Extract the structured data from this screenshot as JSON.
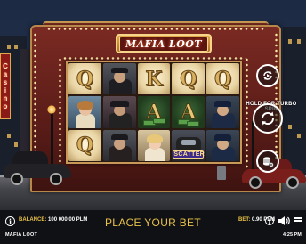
{
  "game": {
    "logo_text": "MAFIA LOOT",
    "side_sign": [
      "C",
      "a",
      "s",
      "i",
      "n",
      "o"
    ],
    "turbo_hint": "HOLD FOR TURBO SPIN",
    "reels": [
      [
        "Q",
        "mobster",
        "K",
        "Q",
        "Q"
      ],
      [
        "lady",
        "boss",
        "A",
        "A",
        "cop"
      ],
      [
        "Q",
        "mobster2",
        "blonde",
        "SCATTER",
        "cop2"
      ]
    ],
    "scatter_label": "SCATTER"
  },
  "bottom_bar": {
    "balance_label": "BALANCE:",
    "balance_value": "100 000.00 PLM",
    "place_bet": "PLACE YOUR BET",
    "bet_label": "BET:",
    "bet_value": "0.90 PLM",
    "game_name": "MAFIA LOOT",
    "time": "4:25 PM"
  },
  "icons": {
    "info": "info-icon",
    "autoplay": "autoplay-icon",
    "spin": "spin-icon",
    "bet_coins": "coins-icon",
    "sound": "sound-icon",
    "menu": "menu-icon"
  },
  "colors": {
    "accent_gold": "#e8c24a",
    "theater_red": "#5a1c18",
    "bar_bg": "#101114"
  }
}
